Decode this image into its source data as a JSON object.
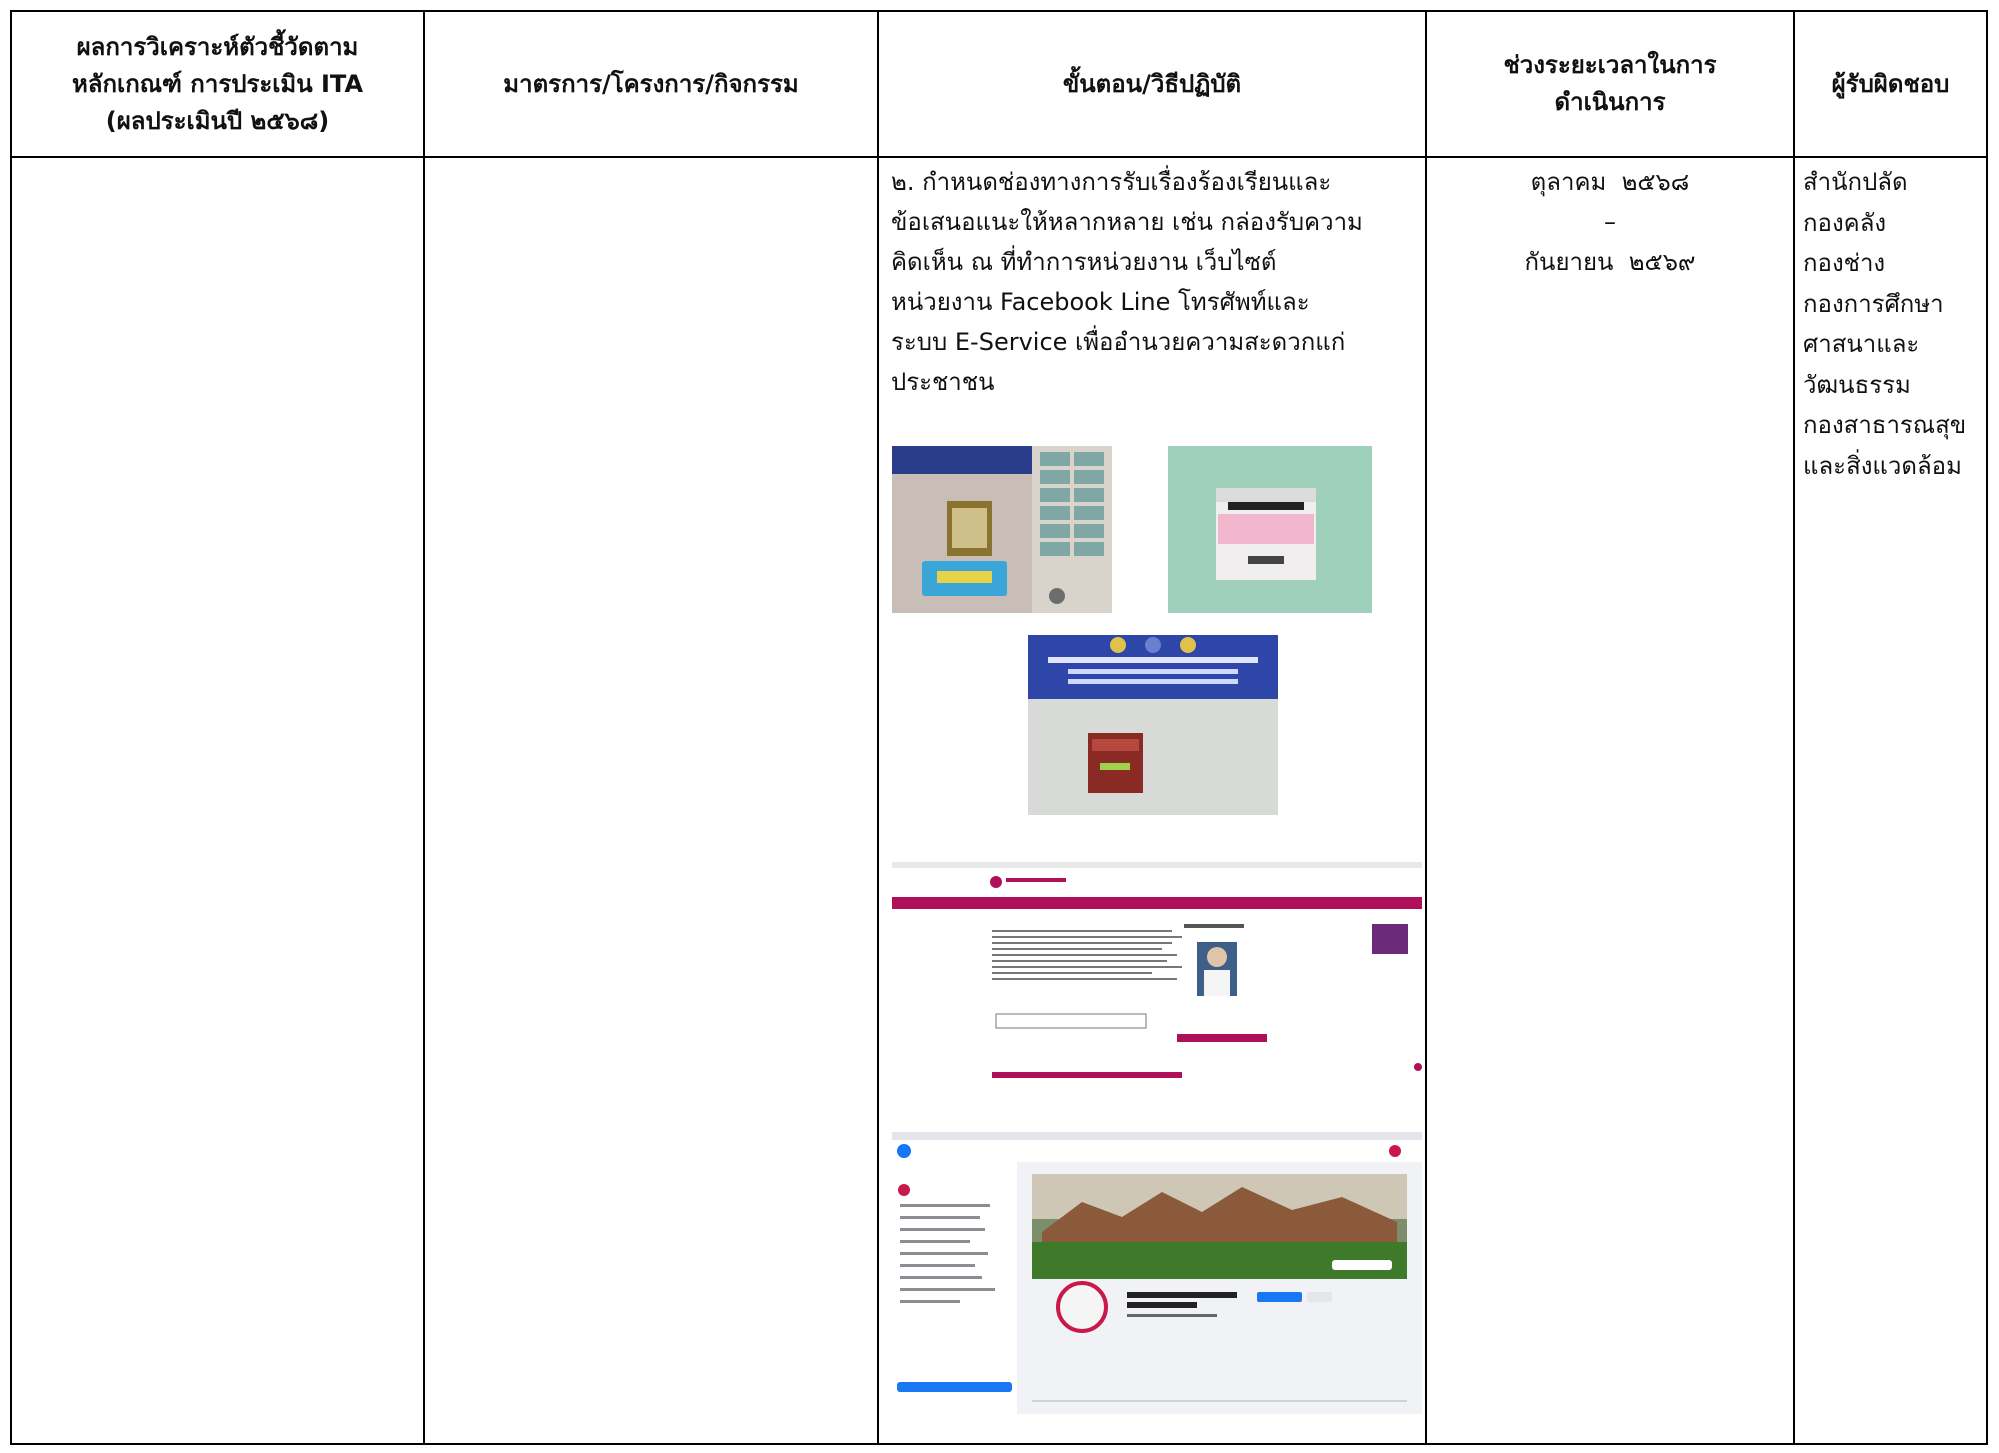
{
  "table": {
    "headers": [
      "ผลการวิเคราะห์ตัวชี้วัดตาม\nหลักเกณฑ์ การประเมิน ITA\n(ผลประเมินปี ๒๕๖๘)",
      "มาตรการ/โครงการ/กิจกรรม",
      "ขั้นตอน/วิธีปฏิบัติ",
      "ช่วงระยะเวลาในการ\nดำเนินการ",
      "ผู้รับผิดชอบ"
    ],
    "procedure_lines": [
      "๒. กำหนดช่องทางการรับเรื่องร้องเรียนและ",
      "ข้อเสนอแนะให้หลากหลาย เช่น กล่องรับความ",
      "คิดเห็น ณ ที่ทำการหน่วยงาน เว็บไซต์",
      "หน่วยงาน Facebook Line โทรศัพท์และ",
      "ระบบ E-Service เพื่ออำนวยความสะดวกแก่",
      "ประชาชน"
    ],
    "period": {
      "start": "ตุลาคม  ๒๕๖๘",
      "separator": "–",
      "end": "กันยายน  ๒๕๖๙"
    },
    "responsible": [
      "สำนักปลัด",
      "กองคลัง",
      "กองช่าง",
      "กองการศึกษา",
      "ศาสนาและ",
      "วัฒนธรรม",
      "กองสาธารณสุข",
      "และสิ่งแวดล้อม"
    ]
  },
  "colors": {
    "border": "#000000",
    "website_accent": "#b0105a",
    "facebook_accent": "#1877f2"
  }
}
